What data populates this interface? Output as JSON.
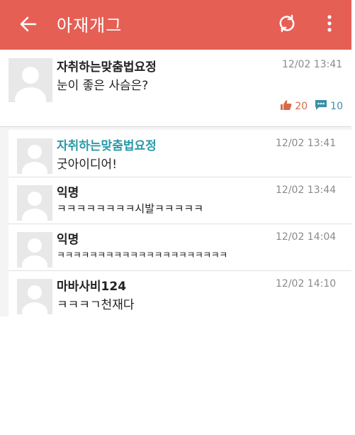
{
  "app": {
    "title": "아재개그"
  },
  "icons": {
    "back": "back-arrow-icon",
    "refresh": "refresh-icon",
    "menu": "more-vert-icon",
    "like": "thumbs-up-icon",
    "comment": "comment-icon"
  },
  "colors": {
    "appbar": "#e65f55",
    "op_author": "#2b9aa8",
    "like": "#d86a48",
    "comment": "#3c8fa6"
  },
  "post": {
    "author": "자취하는맞춤법요정",
    "time": "12/02 13:41",
    "text": "눈이 좋은 사슴은?",
    "likes": "20",
    "comments": "10"
  },
  "comments": [
    {
      "author": "자취하는맞춤법요정",
      "time": "12/02 13:41",
      "text": "굿아이디어!",
      "is_op": true
    },
    {
      "author": "익명",
      "time": "12/02 13:44",
      "text": "ㅋㅋㅋㅋㅋㅋㅋㅋ시발ㅋㅋㅋㅋㅋ",
      "is_op": false
    },
    {
      "author": "익명",
      "time": "12/02 14:04",
      "text": "ㅋㅋㅋㅋㅋㅋㅋㅋㅋㅋㅋㅋㅋㅋㅋㅋㅋㅋㅋㅋㅋ",
      "is_op": false
    },
    {
      "author": "마바사비124",
      "time": "12/02 14:10",
      "text": "ㅋㅋㅋㄱ천재다",
      "is_op": false
    }
  ]
}
